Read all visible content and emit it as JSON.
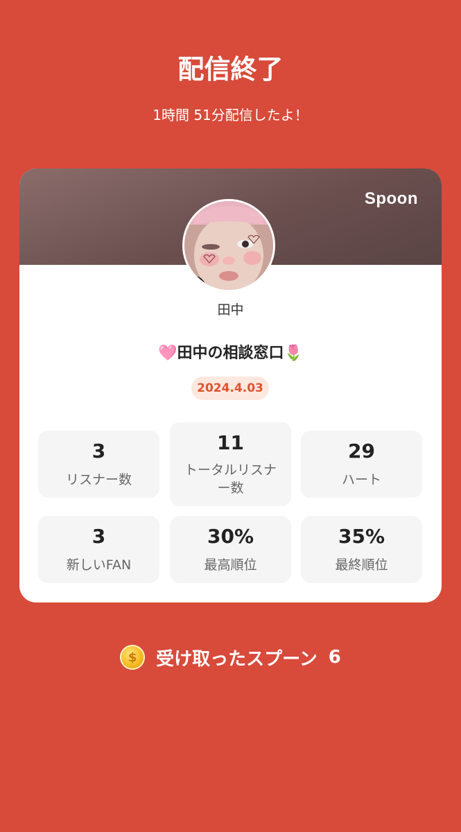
{
  "header": {
    "title": "配信終了",
    "subtitle": "1時間 51分配信したよ！"
  },
  "card": {
    "brand": "Spoon",
    "username": "田中",
    "room_title": "🩷田中の相談窓口🌷",
    "date": "2024.4.03",
    "stats": [
      {
        "value": "3",
        "label": "リスナー数"
      },
      {
        "value": "11",
        "label": "トータルリスナー数"
      },
      {
        "value": "29",
        "label": "ハート"
      },
      {
        "value": "3",
        "label": "新しいFAN"
      },
      {
        "value": "30%",
        "label": "最高順位"
      },
      {
        "value": "35%",
        "label": "最終順位"
      }
    ]
  },
  "spoons": {
    "label": "受け取ったスプーン",
    "count": "6",
    "icon": "coin-icon"
  },
  "colors": {
    "background": "#d84a3a",
    "accent": "#e0532f",
    "banner": "#6b4f4f"
  }
}
